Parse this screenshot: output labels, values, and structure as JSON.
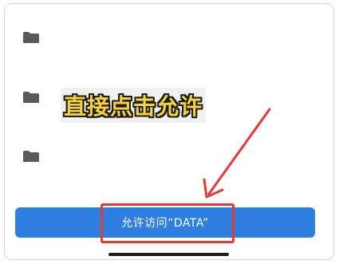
{
  "folders": [
    {
      "icon": "folder-icon"
    },
    {
      "icon": "folder-icon"
    },
    {
      "icon": "folder-icon"
    }
  ],
  "annotation": {
    "overlay_text": "直接点击允许",
    "overlay_color": "#f7d33a",
    "arrow_color": "#e53935"
  },
  "action": {
    "allow_label": "允许访问“DATA”",
    "button_color": "#2f7fe0"
  }
}
